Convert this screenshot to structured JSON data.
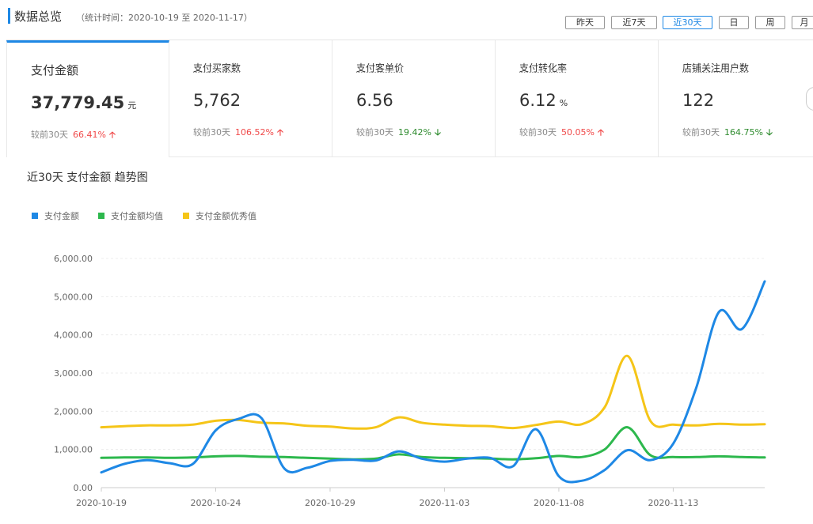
{
  "header": {
    "title": "数据总览",
    "period": "（统计时间：2020-10-19 至 2020-11-17）",
    "range_buttons": [
      "昨天",
      "近7天",
      "近30天",
      "日",
      "周",
      "月"
    ],
    "active_range": "近30天"
  },
  "cards": [
    {
      "label": "支付金额",
      "value": "37,779.45",
      "unit": "元",
      "compare_label": "较前30天",
      "change": "66.41%",
      "direction": "up",
      "active": true
    },
    {
      "label": "支付买家数",
      "value": "5,762",
      "unit": "",
      "compare_label": "较前30天",
      "change": "106.52%",
      "direction": "up"
    },
    {
      "label": "支付客单价",
      "value": "6.56",
      "unit": "",
      "compare_label": "较前30天",
      "change": "19.42%",
      "direction": "down"
    },
    {
      "label": "支付转化率",
      "value": "6.12",
      "unit": "%",
      "compare_label": "较前30天",
      "change": "50.05%",
      "direction": "up"
    },
    {
      "label": "店铺关注用户数",
      "value": "122",
      "unit": "",
      "compare_label": "较前30天",
      "change": "164.75%",
      "direction": "down"
    }
  ],
  "chart_title": "近30天 支付金额 趋势图",
  "colors": {
    "accent": "#1e88e5",
    "up": "#f04848",
    "down": "#2e8b2e"
  },
  "chart_data": {
    "type": "line",
    "legend_position": "top-left",
    "grid": true,
    "ylim": [
      0,
      6000
    ],
    "y_ticks": [
      "0.00",
      "1,000.00",
      "2,000.00",
      "3,000.00",
      "4,000.00",
      "5,000.00",
      "6,000.00"
    ],
    "x_ticks": [
      "2020-10-19",
      "2020-10-24",
      "2020-10-29",
      "2020-11-03",
      "2020-11-08",
      "2020-11-13"
    ],
    "x": [
      "2020-10-19",
      "2020-10-20",
      "2020-10-21",
      "2020-10-22",
      "2020-10-23",
      "2020-10-24",
      "2020-10-25",
      "2020-10-26",
      "2020-10-27",
      "2020-10-28",
      "2020-10-29",
      "2020-10-30",
      "2020-10-31",
      "2020-11-01",
      "2020-11-02",
      "2020-11-03",
      "2020-11-04",
      "2020-11-05",
      "2020-11-06",
      "2020-11-07",
      "2020-11-08",
      "2020-11-09",
      "2020-11-10",
      "2020-11-11",
      "2020-11-12",
      "2020-11-13",
      "2020-11-14",
      "2020-11-15",
      "2020-11-16",
      "2020-11-17"
    ],
    "series": [
      {
        "name": "支付金额",
        "color": "#1e88e5",
        "values": [
          400,
          620,
          720,
          640,
          620,
          1500,
          1800,
          1820,
          500,
          520,
          700,
          730,
          710,
          950,
          760,
          680,
          760,
          780,
          560,
          1530,
          300,
          180,
          460,
          980,
          720,
          1150,
          2600,
          4600,
          4150,
          5400
        ]
      },
      {
        "name": "支付金额均值",
        "color": "#2db84d",
        "values": [
          780,
          790,
          790,
          780,
          790,
          820,
          830,
          810,
          800,
          780,
          760,
          740,
          760,
          870,
          800,
          780,
          770,
          760,
          740,
          770,
          830,
          800,
          1000,
          1580,
          850,
          800,
          800,
          820,
          800,
          790
        ]
      },
      {
        "name": "支付金额优秀值",
        "color": "#f5c518",
        "values": [
          1580,
          1610,
          1630,
          1630,
          1650,
          1750,
          1770,
          1700,
          1680,
          1620,
          1600,
          1550,
          1580,
          1840,
          1700,
          1650,
          1620,
          1610,
          1560,
          1640,
          1730,
          1660,
          2100,
          3450,
          1750,
          1650,
          1630,
          1670,
          1650,
          1660
        ]
      }
    ]
  }
}
